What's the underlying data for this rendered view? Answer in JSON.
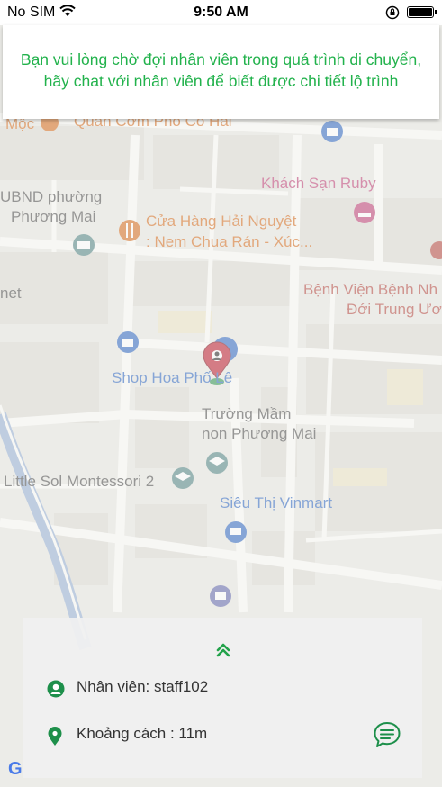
{
  "status_bar": {
    "carrier": "No SIM",
    "time": "9:50 AM"
  },
  "notice": {
    "message": "Bạn vui lòng chờ đợi nhân viên trong quá trình di chuyển, hãy chat với nhân viên để biết được chi tiết lộ trình"
  },
  "map": {
    "labels": {
      "quan_com": "Quán Cơm Phố Cổ Hải",
      "moc": "Mộc",
      "khach_san": "Khách Sạn Ruby",
      "ubnd_1": "UBND phường",
      "ubnd_2": "Phương Mai",
      "cua_hang_1": "Cửa Hàng Hải Nguyệt",
      "cua_hang_2": ": Nem Chua Rán -  Xúc...",
      "benh_vien_1": "Bệnh Viện Bệnh Nh",
      "benh_vien_2": "Đới Trung Ươ",
      "net": "net",
      "shop_hoa": "Shop Hoa Phố Lê",
      "truong_mam_1": "Trường Mầm",
      "truong_mam_2": "non Phương Mai",
      "little_sol": "Little Sol Montessori 2",
      "sieu_thi": "Siêu Thị Vinmart"
    }
  },
  "panel": {
    "staff": "Nhân viên: staff102",
    "distance": "Khoảng cách : 11m"
  },
  "colors": {
    "accent_green": "#22b24c",
    "map_blue": "#3a6fc4",
    "map_orange": "#d8742a",
    "map_pink": "#c2497c",
    "map_red": "#b8514a"
  }
}
